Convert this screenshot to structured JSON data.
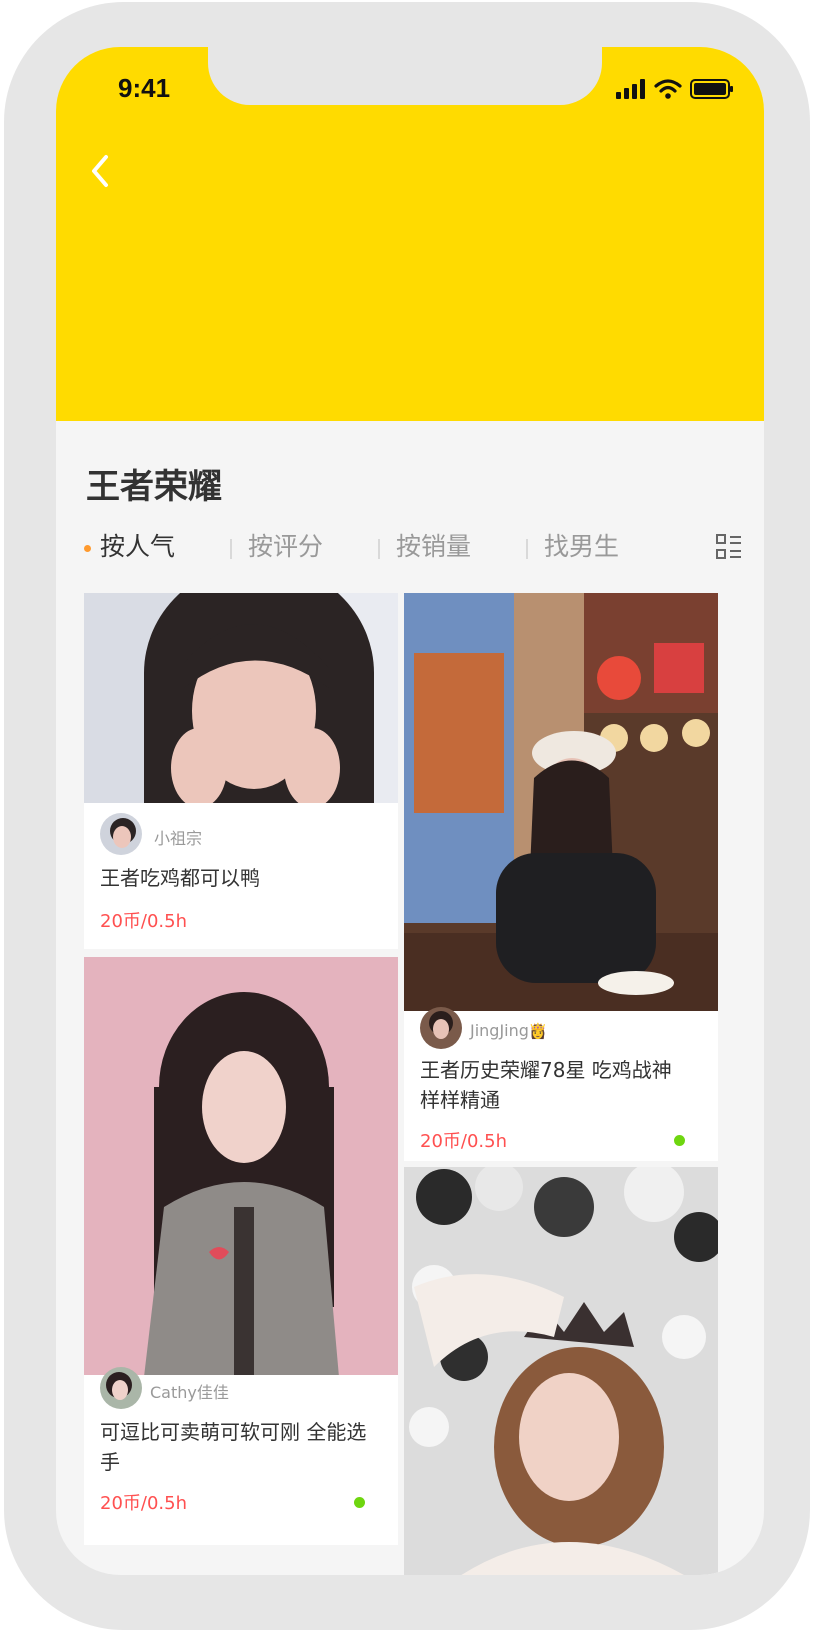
{
  "status_bar": {
    "time": "9:41"
  },
  "page": {
    "title": "王者荣耀"
  },
  "tabs": [
    {
      "label": "按人气",
      "active": true
    },
    {
      "label": "按评分",
      "active": false
    },
    {
      "label": "按销量",
      "active": false
    },
    {
      "label": "找男生",
      "active": false
    }
  ],
  "cards": [
    {
      "nickname": "小祖宗",
      "description": "王者吃鸡都可以鸭",
      "price": "20币/0.5h"
    },
    {
      "nickname": "JingJing",
      "badge_icon": "crown-emoji",
      "description": "王者历史荣耀78星 吃鸡战神 样样精通",
      "price": "20币/0.5h",
      "online": true
    },
    {
      "nickname": "Cathy佳佳",
      "description": "可逗比可卖萌可软可刚 全能选手",
      "price": "20币/0.5h",
      "online": true
    },
    {
      "nickname": "",
      "description": "",
      "price": ""
    }
  ],
  "colors": {
    "header": "#ffdb00",
    "price": "#ff5050",
    "online": "#6ed60f",
    "active_dot": "#ff9a2e"
  }
}
